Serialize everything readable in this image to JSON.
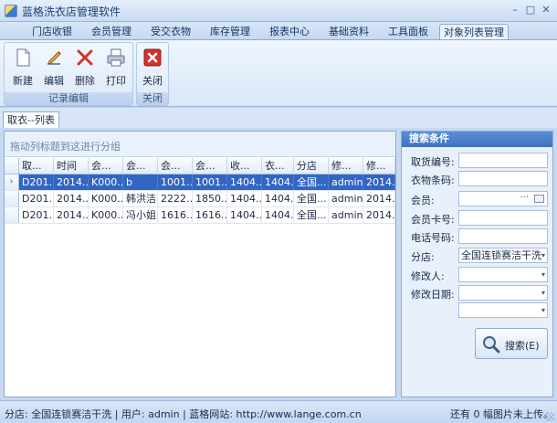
{
  "window": {
    "title": "蓝格洗衣店管理软件",
    "controls": {
      "minimize": "–",
      "maximize": "□",
      "close": "✕"
    }
  },
  "ribbon_tabs": [
    "门店收银",
    "会员管理",
    "受交衣物",
    "库存管理",
    "报表中心",
    "基础资料",
    "工具面板",
    "对象列表管理"
  ],
  "active_tab": "对象列表管理",
  "ribbon_groups": [
    {
      "caption": "记录编辑",
      "buttons": [
        {
          "label": "新建",
          "icon": "new-document-icon"
        },
        {
          "label": "编辑",
          "icon": "pencil-edit-icon"
        },
        {
          "label": "删除",
          "icon": "delete-x-icon"
        },
        {
          "label": "打印",
          "icon": "printer-icon"
        }
      ]
    },
    {
      "caption": "关闭",
      "buttons": [
        {
          "label": "关闭",
          "icon": "close-red-icon"
        }
      ]
    }
  ],
  "document_tab": "取衣--列表",
  "grid": {
    "group_hint": "拖动列标题到这进行分组",
    "columns": [
      "取...",
      "时间",
      "会...",
      "会...",
      "会...",
      "会...",
      "收...",
      "衣...",
      "分店",
      "修...",
      "修..."
    ],
    "rows": [
      [
        "D201...",
        "2014...",
        "K000...",
        "b",
        "1001...",
        "1001...",
        "1404...",
        "1404...",
        "全国...",
        "admin",
        "2014..."
      ],
      [
        "D201...",
        "2014...",
        "K000...",
        "韩洪洁",
        "2222...",
        "1850...",
        "1404...",
        "1404...",
        "全国...",
        "admin",
        "2014..."
      ],
      [
        "D201...",
        "2014...",
        "K000...",
        "冯小姐",
        "1616...",
        "1616...",
        "1404...",
        "1404...",
        "全国...",
        "admin",
        "2014..."
      ]
    ],
    "selected_row_marker": "›"
  },
  "search": {
    "header": "搜索条件",
    "fields": [
      {
        "label": "取货编号:",
        "value": ""
      },
      {
        "label": "衣物条码:",
        "value": ""
      },
      {
        "label": "会员:",
        "value": ""
      },
      {
        "label": "会员卡号:",
        "value": ""
      },
      {
        "label": "电话号码:",
        "value": ""
      },
      {
        "label": "分店:",
        "value": "全国连锁赛洁干洗"
      },
      {
        "label": "修改人:",
        "value": ""
      },
      {
        "label": "修改日期:",
        "value": ""
      },
      {
        "label": "",
        "value": ""
      }
    ],
    "member_dots": "···",
    "dropdown_arrow": "▾",
    "button_label": "搜索(E)"
  },
  "status": {
    "left": "分店: 全国连锁赛洁干洗 | 用户: admin | 蓝格网站: http://www.lange.com.cn",
    "right": "还有 0 幅图片未上传。"
  },
  "colors": {
    "selection": "#3266c4",
    "panel_header": "#3f72bd",
    "delete_red": "#d0342c"
  }
}
